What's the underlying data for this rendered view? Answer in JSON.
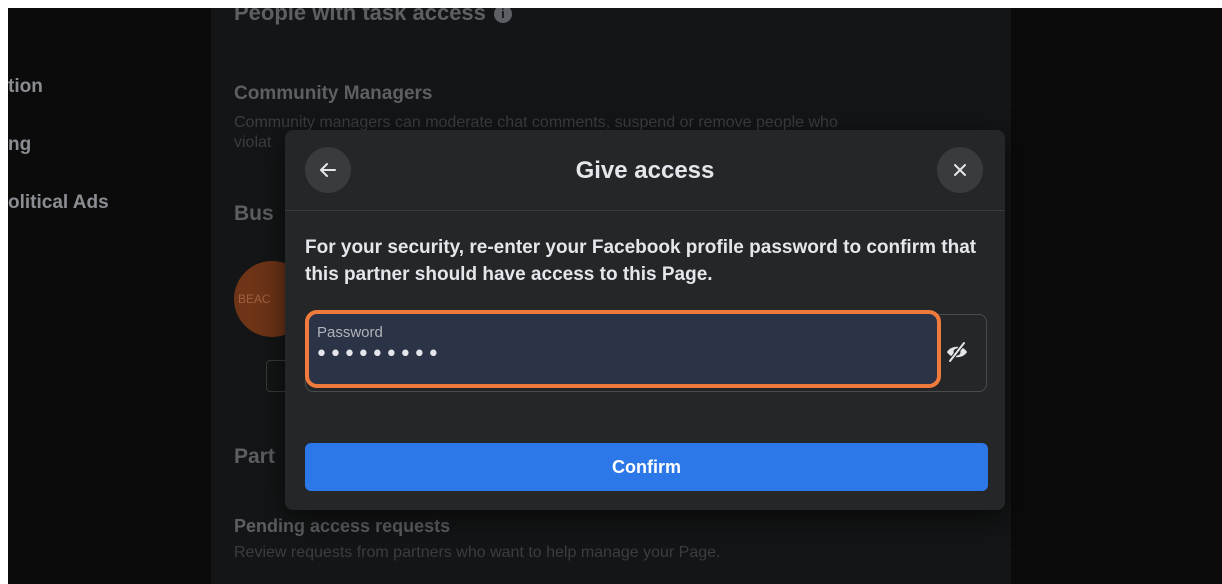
{
  "sidebar": {
    "items": [
      {
        "label": "tion"
      },
      {
        "label": "ng"
      },
      {
        "label": "olitical Ads"
      }
    ]
  },
  "background": {
    "people_heading": "People with task access",
    "community_heading": "Community Managers",
    "community_desc": "Community managers can moderate chat comments, suspend or remove people who",
    "community_desc_cont": "violat",
    "bus_heading": "Bus",
    "avatar_text": "BEAC",
    "part_heading": "Part",
    "pending_heading": "Pending access requests",
    "pending_desc": "Review requests from partners who want to help manage your Page."
  },
  "modal": {
    "title": "Give access",
    "message": "For your security, re-enter your Facebook profile password to confirm that this partner should have access to this Page.",
    "password_label": "Password",
    "password_value": "•••••••••",
    "confirm_label": "Confirm"
  },
  "colors": {
    "highlight": "#f07a3c",
    "primary_button": "#2d78e8",
    "modal_bg": "#252628"
  },
  "icons": {
    "back": "arrow-left-icon",
    "close": "close-icon",
    "password_toggle": "eye-slash-icon",
    "info": "info-icon"
  }
}
